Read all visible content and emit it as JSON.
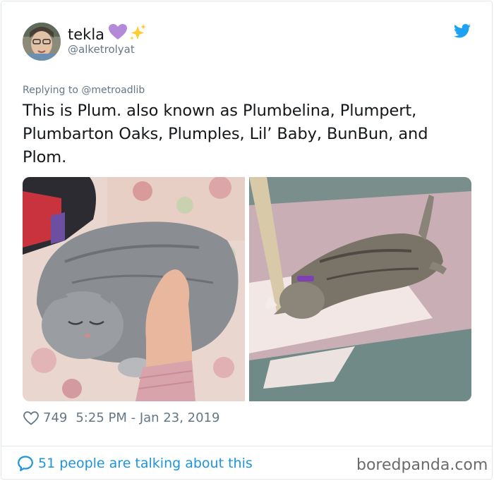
{
  "author": {
    "display_name": "tekla",
    "handle": "@alketrolyat",
    "name_emoji": "heart-sparkles"
  },
  "reply_to": "Replying to @metroadlib",
  "tweet": {
    "line1": "This is Plum. also known as Plumbelina, Plumpert,",
    "line2": "Plumbarton Oaks, Plumples, Lil’ Baby, BunBun, and",
    "line3": "Plom."
  },
  "meta": {
    "likes": "749",
    "timestamp": "5:25 PM - Jan 23, 2019"
  },
  "footer": {
    "talking": "51 people are talking about this",
    "watermark": "boredpanda.com"
  },
  "colors": {
    "twitter_blue": "#1da1f2",
    "link_blue": "#1b95e0",
    "text": "#14171a",
    "muted": "#657786",
    "heart_purple": "#b38ad9"
  },
  "icons": [
    "twitter-bird-icon",
    "heart-icon",
    "speech-bubble-icon",
    "purple-heart-emoji",
    "sparkles-emoji"
  ]
}
